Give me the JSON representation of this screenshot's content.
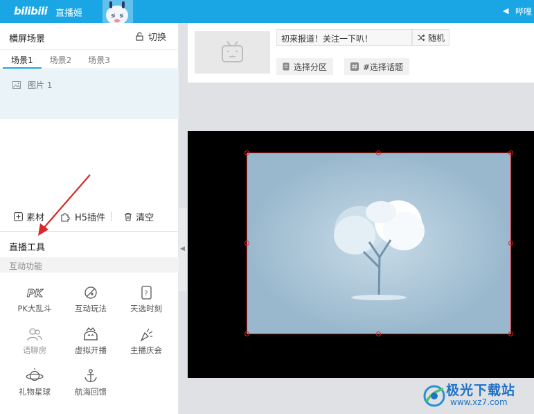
{
  "app": {
    "logo": "bilibili",
    "name": "直播姬",
    "notice_text": "哔哩"
  },
  "scene": {
    "title": "横屏场景",
    "switch_label": "切换",
    "tabs": [
      {
        "label": "场景1",
        "active": true
      },
      {
        "label": "场景2",
        "active": false
      },
      {
        "label": "场景3",
        "active": false
      }
    ],
    "sources": [
      {
        "label": "图片 1",
        "icon": "image-icon"
      }
    ]
  },
  "toolbar": {
    "material_label": "素材",
    "h5_plugin_label": "H5插件",
    "clear_label": "清空"
  },
  "live_tools": {
    "title": "直播工具",
    "section_label": "互动功能",
    "items": [
      {
        "label": "PK大乱斗",
        "icon": "pk-icon",
        "enabled": true
      },
      {
        "label": "互动玩法",
        "icon": "planet-slash-icon",
        "enabled": true
      },
      {
        "label": "天选时刻",
        "icon": "question-card-icon",
        "enabled": true
      },
      {
        "label": "语聊房",
        "icon": "voice-room-icon",
        "enabled": false
      },
      {
        "label": "虚拟开播",
        "icon": "virtual-avatar-icon",
        "enabled": true
      },
      {
        "label": "主播庆会",
        "icon": "party-popper-icon",
        "enabled": true
      },
      {
        "label": "礼物星球",
        "icon": "gift-planet-icon",
        "enabled": true
      },
      {
        "label": "航海回馈",
        "icon": "anchor-icon",
        "enabled": true
      }
    ]
  },
  "room": {
    "title_value": "初来报道！关注一下叭！",
    "random_label": "随机",
    "select_area_label": "选择分区",
    "select_topic_label": "#选择话题"
  },
  "watermark": {
    "title": "极光下载站",
    "url": "www.xz7.com"
  },
  "colors": {
    "titlebar": "#1aa5e5",
    "selection_border": "#e02525",
    "arrow": "#d42a2a",
    "preview_bg": "#000000",
    "image_bg": "#9ab8cd"
  }
}
